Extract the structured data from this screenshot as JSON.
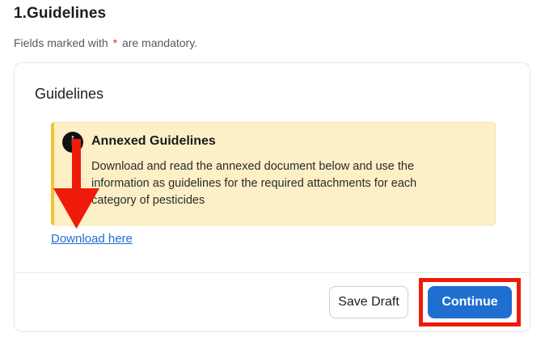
{
  "section": {
    "title": "1.Guidelines",
    "mandatory_prefix": "Fields marked with",
    "mandatory_marker": "*",
    "mandatory_suffix": "are mandatory."
  },
  "card": {
    "title": "Guidelines",
    "alert": {
      "icon": "info-icon",
      "title": "Annexed Guidelines",
      "text": "Download and read the annexed document below and use the information as guidelines for the required attachments for each category of pesticides"
    },
    "download_link": "Download here",
    "save_draft_label": "Save Draft",
    "continue_label": "Continue"
  },
  "annotations": {
    "highlight_color": "#ee1b0a",
    "arrow_color": "#ee1b0a"
  },
  "colors": {
    "primary": "#1f6fd1",
    "alert_bg": "#fdf0c7",
    "alert_border": "#f4c430",
    "required": "#e02424"
  }
}
